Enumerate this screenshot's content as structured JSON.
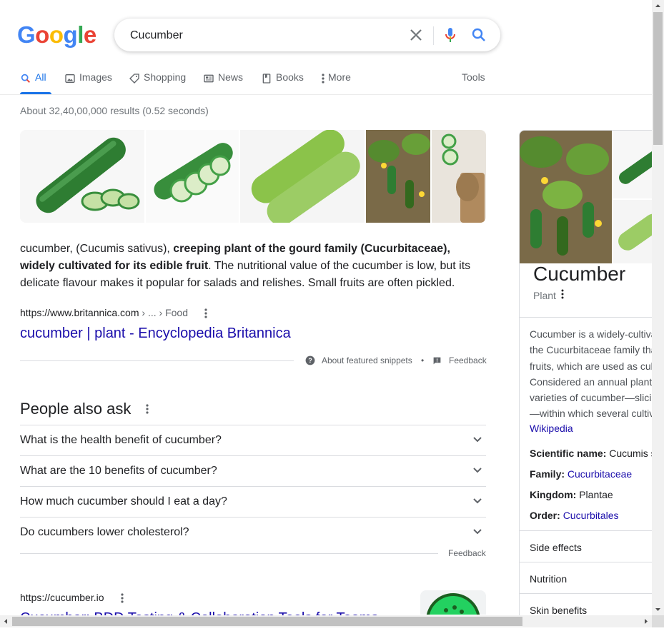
{
  "logo": {
    "letters": [
      "G",
      "o",
      "o",
      "g",
      "l",
      "e"
    ],
    "colors": [
      "#4285F4",
      "#EA4335",
      "#FBBC05",
      "#4285F4",
      "#34A853",
      "#EA4335"
    ]
  },
  "search": {
    "query": "Cucumber"
  },
  "tabs": [
    {
      "label": "All",
      "icon": "search-icon",
      "active": true
    },
    {
      "label": "Images",
      "icon": "image-icon"
    },
    {
      "label": "Shopping",
      "icon": "tag-icon"
    },
    {
      "label": "News",
      "icon": "newspaper-icon"
    },
    {
      "label": "Books",
      "icon": "book-icon"
    },
    {
      "label": "More",
      "icon": "vertical-dots-icon"
    }
  ],
  "tools_label": "Tools",
  "result_stats": "About 32,40,00,000 results (0.52 seconds)",
  "featured_snippet": {
    "text_part1": "cucumber, (Cucumis sativus), ",
    "text_bold": "creeping plant of the gourd family (Cucurbitaceae), widely cultivated for its edible fruit",
    "text_part2": ". The nutritional value of the cucumber is low, but its delicate flavour makes it popular for salads and relishes. Small fruits are often pickled.",
    "cite_domain": "https://www.britannica.com",
    "cite_path": " › ... › Food",
    "title": "cucumber | plant - Encyclopedia Britannica",
    "about_label": "About featured snippets",
    "dot": "•",
    "feedback_label": "Feedback"
  },
  "paa": {
    "title": "People also ask",
    "questions": [
      "What is the health benefit of cucumber?",
      "What are the 10 benefits of cucumber?",
      "How much cucumber should I eat a day?",
      "Do cucumbers lower cholesterol?"
    ],
    "feedback_label": "Feedback"
  },
  "result2": {
    "cite": "https://cucumber.io",
    "title": "Cucumber: BDD Testing & Collaboration Tools for Teams"
  },
  "knowledge_panel": {
    "title": "Cucumber",
    "subtitle": "Plant",
    "desc_lines": [
      "Cucumber is a widely-cultivated",
      "the Cucurbitaceae family that",
      "fruits, which are used as culinary",
      "Considered an annual plant,",
      "varieties of cucumber—slicing,",
      "—within which several cultivars"
    ],
    "wiki_label": "Wikipedia",
    "facts": [
      {
        "label": "Scientific name: ",
        "value": "Cucumis sativus",
        "link": false
      },
      {
        "label": "Family: ",
        "value": "Cucurbitaceae",
        "link": true
      },
      {
        "label": "Kingdom: ",
        "value": "Plantae",
        "link": false
      },
      {
        "label": "Order: ",
        "value": "Cucurbitales",
        "link": true
      }
    ],
    "rows": [
      "Side effects",
      "Nutrition",
      "Skin benefits"
    ]
  }
}
